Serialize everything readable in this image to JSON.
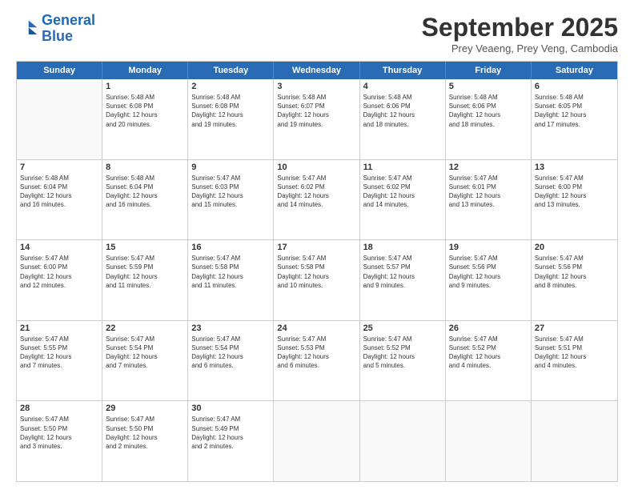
{
  "logo": {
    "line1": "General",
    "line2": "Blue"
  },
  "title": "September 2025",
  "subtitle": "Prey Veaeng, Prey Veng, Cambodia",
  "header_days": [
    "Sunday",
    "Monday",
    "Tuesday",
    "Wednesday",
    "Thursday",
    "Friday",
    "Saturday"
  ],
  "weeks": [
    [
      {
        "day": "",
        "info": ""
      },
      {
        "day": "1",
        "info": "Sunrise: 5:48 AM\nSunset: 6:08 PM\nDaylight: 12 hours\nand 20 minutes."
      },
      {
        "day": "2",
        "info": "Sunrise: 5:48 AM\nSunset: 6:08 PM\nDaylight: 12 hours\nand 19 minutes."
      },
      {
        "day": "3",
        "info": "Sunrise: 5:48 AM\nSunset: 6:07 PM\nDaylight: 12 hours\nand 19 minutes."
      },
      {
        "day": "4",
        "info": "Sunrise: 5:48 AM\nSunset: 6:06 PM\nDaylight: 12 hours\nand 18 minutes."
      },
      {
        "day": "5",
        "info": "Sunrise: 5:48 AM\nSunset: 6:06 PM\nDaylight: 12 hours\nand 18 minutes."
      },
      {
        "day": "6",
        "info": "Sunrise: 5:48 AM\nSunset: 6:05 PM\nDaylight: 12 hours\nand 17 minutes."
      }
    ],
    [
      {
        "day": "7",
        "info": "Sunrise: 5:48 AM\nSunset: 6:04 PM\nDaylight: 12 hours\nand 16 minutes."
      },
      {
        "day": "8",
        "info": "Sunrise: 5:48 AM\nSunset: 6:04 PM\nDaylight: 12 hours\nand 16 minutes."
      },
      {
        "day": "9",
        "info": "Sunrise: 5:47 AM\nSunset: 6:03 PM\nDaylight: 12 hours\nand 15 minutes."
      },
      {
        "day": "10",
        "info": "Sunrise: 5:47 AM\nSunset: 6:02 PM\nDaylight: 12 hours\nand 14 minutes."
      },
      {
        "day": "11",
        "info": "Sunrise: 5:47 AM\nSunset: 6:02 PM\nDaylight: 12 hours\nand 14 minutes."
      },
      {
        "day": "12",
        "info": "Sunrise: 5:47 AM\nSunset: 6:01 PM\nDaylight: 12 hours\nand 13 minutes."
      },
      {
        "day": "13",
        "info": "Sunrise: 5:47 AM\nSunset: 6:00 PM\nDaylight: 12 hours\nand 13 minutes."
      }
    ],
    [
      {
        "day": "14",
        "info": "Sunrise: 5:47 AM\nSunset: 6:00 PM\nDaylight: 12 hours\nand 12 minutes."
      },
      {
        "day": "15",
        "info": "Sunrise: 5:47 AM\nSunset: 5:59 PM\nDaylight: 12 hours\nand 11 minutes."
      },
      {
        "day": "16",
        "info": "Sunrise: 5:47 AM\nSunset: 5:58 PM\nDaylight: 12 hours\nand 11 minutes."
      },
      {
        "day": "17",
        "info": "Sunrise: 5:47 AM\nSunset: 5:58 PM\nDaylight: 12 hours\nand 10 minutes."
      },
      {
        "day": "18",
        "info": "Sunrise: 5:47 AM\nSunset: 5:57 PM\nDaylight: 12 hours\nand 9 minutes."
      },
      {
        "day": "19",
        "info": "Sunrise: 5:47 AM\nSunset: 5:56 PM\nDaylight: 12 hours\nand 9 minutes."
      },
      {
        "day": "20",
        "info": "Sunrise: 5:47 AM\nSunset: 5:56 PM\nDaylight: 12 hours\nand 8 minutes."
      }
    ],
    [
      {
        "day": "21",
        "info": "Sunrise: 5:47 AM\nSunset: 5:55 PM\nDaylight: 12 hours\nand 7 minutes."
      },
      {
        "day": "22",
        "info": "Sunrise: 5:47 AM\nSunset: 5:54 PM\nDaylight: 12 hours\nand 7 minutes."
      },
      {
        "day": "23",
        "info": "Sunrise: 5:47 AM\nSunset: 5:54 PM\nDaylight: 12 hours\nand 6 minutes."
      },
      {
        "day": "24",
        "info": "Sunrise: 5:47 AM\nSunset: 5:53 PM\nDaylight: 12 hours\nand 6 minutes."
      },
      {
        "day": "25",
        "info": "Sunrise: 5:47 AM\nSunset: 5:52 PM\nDaylight: 12 hours\nand 5 minutes."
      },
      {
        "day": "26",
        "info": "Sunrise: 5:47 AM\nSunset: 5:52 PM\nDaylight: 12 hours\nand 4 minutes."
      },
      {
        "day": "27",
        "info": "Sunrise: 5:47 AM\nSunset: 5:51 PM\nDaylight: 12 hours\nand 4 minutes."
      }
    ],
    [
      {
        "day": "28",
        "info": "Sunrise: 5:47 AM\nSunset: 5:50 PM\nDaylight: 12 hours\nand 3 minutes."
      },
      {
        "day": "29",
        "info": "Sunrise: 5:47 AM\nSunset: 5:50 PM\nDaylight: 12 hours\nand 2 minutes."
      },
      {
        "day": "30",
        "info": "Sunrise: 5:47 AM\nSunset: 5:49 PM\nDaylight: 12 hours\nand 2 minutes."
      },
      {
        "day": "",
        "info": ""
      },
      {
        "day": "",
        "info": ""
      },
      {
        "day": "",
        "info": ""
      },
      {
        "day": "",
        "info": ""
      }
    ]
  ]
}
